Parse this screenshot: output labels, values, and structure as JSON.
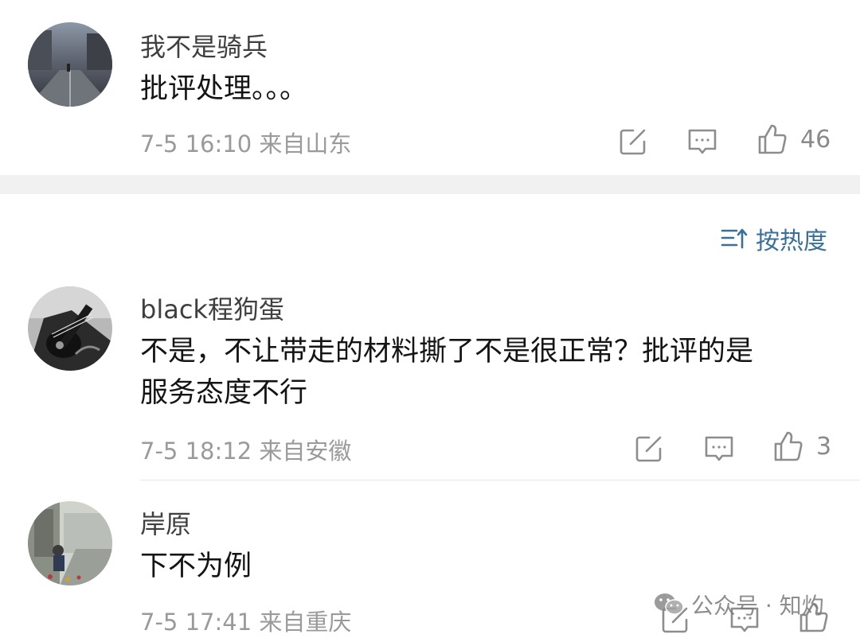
{
  "comments": [
    {
      "username": "我不是骑兵",
      "text_lines": [
        "批评处理。。。"
      ],
      "date": "7-5 16:10",
      "location": "来自山东",
      "like_count": "46"
    },
    {
      "username": "black程狗蛋",
      "text_lines": [
        "不是，不让带走的材料撕了不是很正常？批评的是",
        "服务态度不行"
      ],
      "date": "7-5 18:12",
      "location": "来自安徽",
      "like_count": "3"
    },
    {
      "username": "岸原",
      "text_lines": [
        "下不为例"
      ],
      "date": "7-5 17:41",
      "location": "来自重庆",
      "like_count": ""
    }
  ],
  "sort": {
    "label": "按热度",
    "icon": "sort-icon",
    "color": "#3a6f99"
  },
  "watermark": {
    "label": "公众号 · 知灼",
    "icon": "wechat-icon"
  },
  "icons": {
    "share": "share-icon",
    "reply": "comment-icon",
    "like": "thumbs-up-icon"
  }
}
